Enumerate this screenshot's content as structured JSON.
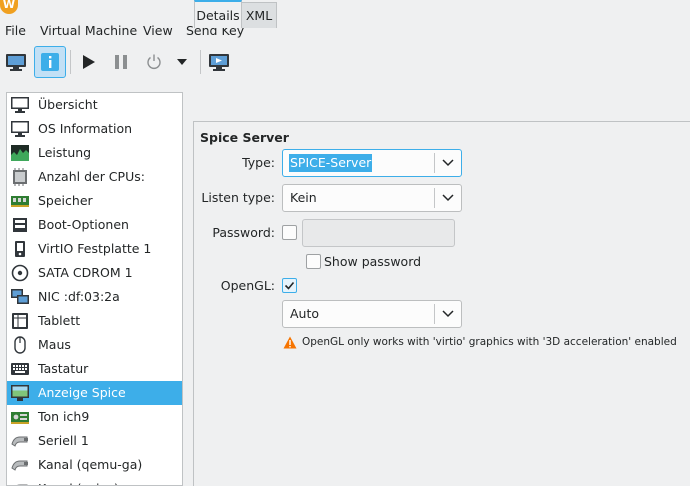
{
  "menubar": {
    "items": [
      "File",
      "Virtual Machine",
      "View",
      "Send Key"
    ]
  },
  "toolbar": {
    "buttons": [
      "console-icon",
      "info-icon",
      "run-icon",
      "pause-icon",
      "power-icon",
      "dropdown-arrow-icon",
      "screenshot-icon"
    ],
    "active": "info-icon"
  },
  "sidebar": {
    "items": [
      {
        "label": "Übersicht",
        "icon": "monitor-icon"
      },
      {
        "label": "OS Information",
        "icon": "monitor-icon"
      },
      {
        "label": "Leistung",
        "icon": "performance-graph-icon"
      },
      {
        "label": "Anzahl der CPUs:",
        "icon": "cpu-icon"
      },
      {
        "label": "Speicher",
        "icon": "memory-icon"
      },
      {
        "label": "Boot-Optionen",
        "icon": "boot-options-icon"
      },
      {
        "label": "VirtIO Festplatte 1",
        "icon": "disk-icon"
      },
      {
        "label": "SATA CDROM 1",
        "icon": "cdrom-icon"
      },
      {
        "label": "NIC :df:03:2a",
        "icon": "network-icon"
      },
      {
        "label": "Tablett",
        "icon": "tablet-icon"
      },
      {
        "label": "Maus",
        "icon": "mouse-icon"
      },
      {
        "label": "Tastatur",
        "icon": "keyboard-icon"
      },
      {
        "label": "Anzeige Spice",
        "icon": "display-icon"
      },
      {
        "label": "Ton ich9",
        "icon": "sound-card-icon"
      },
      {
        "label": "Seriell 1",
        "icon": "serial-icon"
      },
      {
        "label": "Kanal (qemu-ga)",
        "icon": "channel-icon"
      },
      {
        "label": "Kanal (spice)",
        "icon": "channel-icon"
      }
    ],
    "selected_index": 12
  },
  "tabs": [
    {
      "label": "Details",
      "active": true
    },
    {
      "label": "XML",
      "active": false
    }
  ],
  "form": {
    "section_title": "Spice Server",
    "type_label": "Type:",
    "type_value": "SPICE-Server",
    "listen_label": "Listen type:",
    "listen_value": "Kein",
    "password_label": "Password:",
    "password_checked": false,
    "password_value": "",
    "show_password_label": "Show password",
    "show_password_checked": false,
    "opengl_label": "OpenGL:",
    "opengl_checked": true,
    "opengl_device_value": "Auto",
    "warning_text": "OpenGL only works with 'virtio' graphics with '3D acceleration' enabled"
  },
  "colors": {
    "accent": "#3daee9",
    "warning": "#f67400",
    "window_bg": "#eff0f1"
  }
}
